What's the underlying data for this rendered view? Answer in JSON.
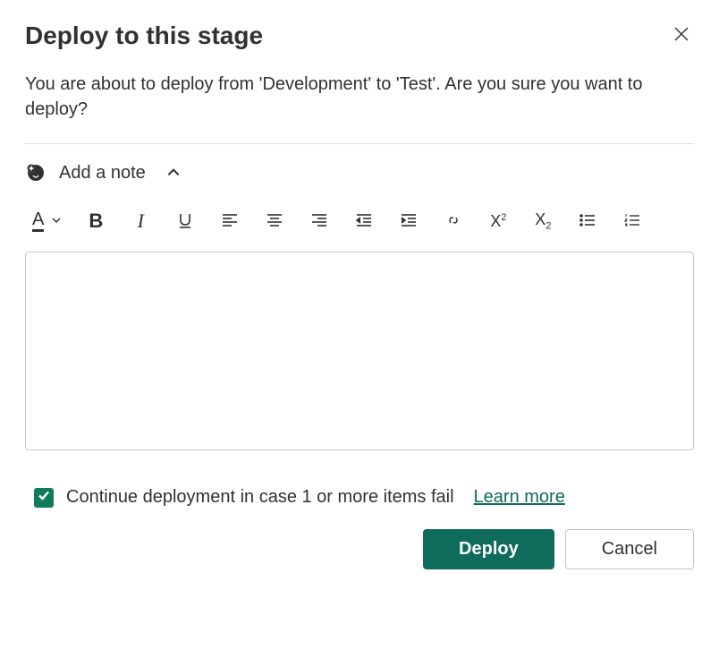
{
  "dialog": {
    "title": "Deploy to this stage",
    "description": "You are about to deploy from 'Development' to 'Test'. Are you sure you want to deploy?"
  },
  "note": {
    "label": "Add a note",
    "expanded": true,
    "content": ""
  },
  "toolbar": {
    "font_color": "Font color",
    "bold": "Bold",
    "italic": "Italic",
    "underline": "Underline",
    "align_left": "Align left",
    "align_center": "Align center",
    "align_right": "Align right",
    "decrease_indent": "Decrease indent",
    "increase_indent": "Increase indent",
    "link": "Insert link",
    "superscript": "Superscript",
    "subscript": "Subscript",
    "bullet_list": "Bulleted list",
    "number_list": "Numbered list"
  },
  "options": {
    "continue_on_fail_checked": true,
    "continue_on_fail_label": "Continue deployment in case 1 or more items fail",
    "learn_more": "Learn more"
  },
  "buttons": {
    "primary": "Deploy",
    "secondary": "Cancel"
  },
  "colors": {
    "accent": "#0f6b5c",
    "checkbox": "#107c59"
  }
}
